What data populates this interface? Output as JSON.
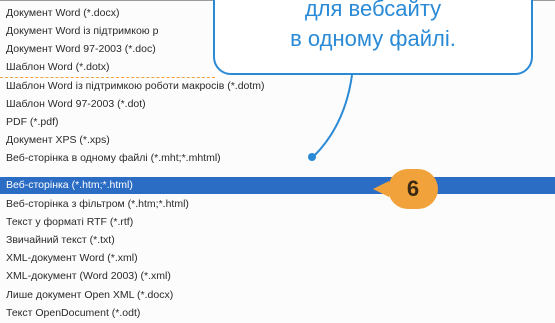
{
  "file_types": {
    "items": [
      "Документ Word (*.docx)",
      "Документ Word із підтримкою р",
      "Документ Word 97-2003 (*.doc)",
      "Шаблон Word (*.dotx)",
      "Шаблон Word із підтримкою роботи макросів (*.dotm)",
      "Шаблон Word 97-2003 (*.dot)",
      "PDF (*.pdf)",
      "Документ XPS (*.xps)",
      "Веб-сторінка в одному файлі (*.mht;*.mhtml)",
      "Веб-сторінка (*.htm;*.html)",
      "Веб-сторінка з фільтром (*.htm;*.html)",
      "Текст у форматі RTF (*.rtf)",
      "Звичайний текст (*.txt)",
      "XML-документ Word (*.xml)",
      "XML-документ (Word 2003) (*.xml)",
      "Лише документ Open XML (*.docx)",
      "Текст OpenDocument (*.odt)"
    ],
    "selected_index": 9
  },
  "callout": {
    "line1": "для вебсайту",
    "line2": "в одному файлі."
  },
  "badge": {
    "number": "6"
  },
  "colors": {
    "selection": "#2b6cc4",
    "callout_border": "#2a8ad6",
    "badge": "#f2a23a"
  }
}
